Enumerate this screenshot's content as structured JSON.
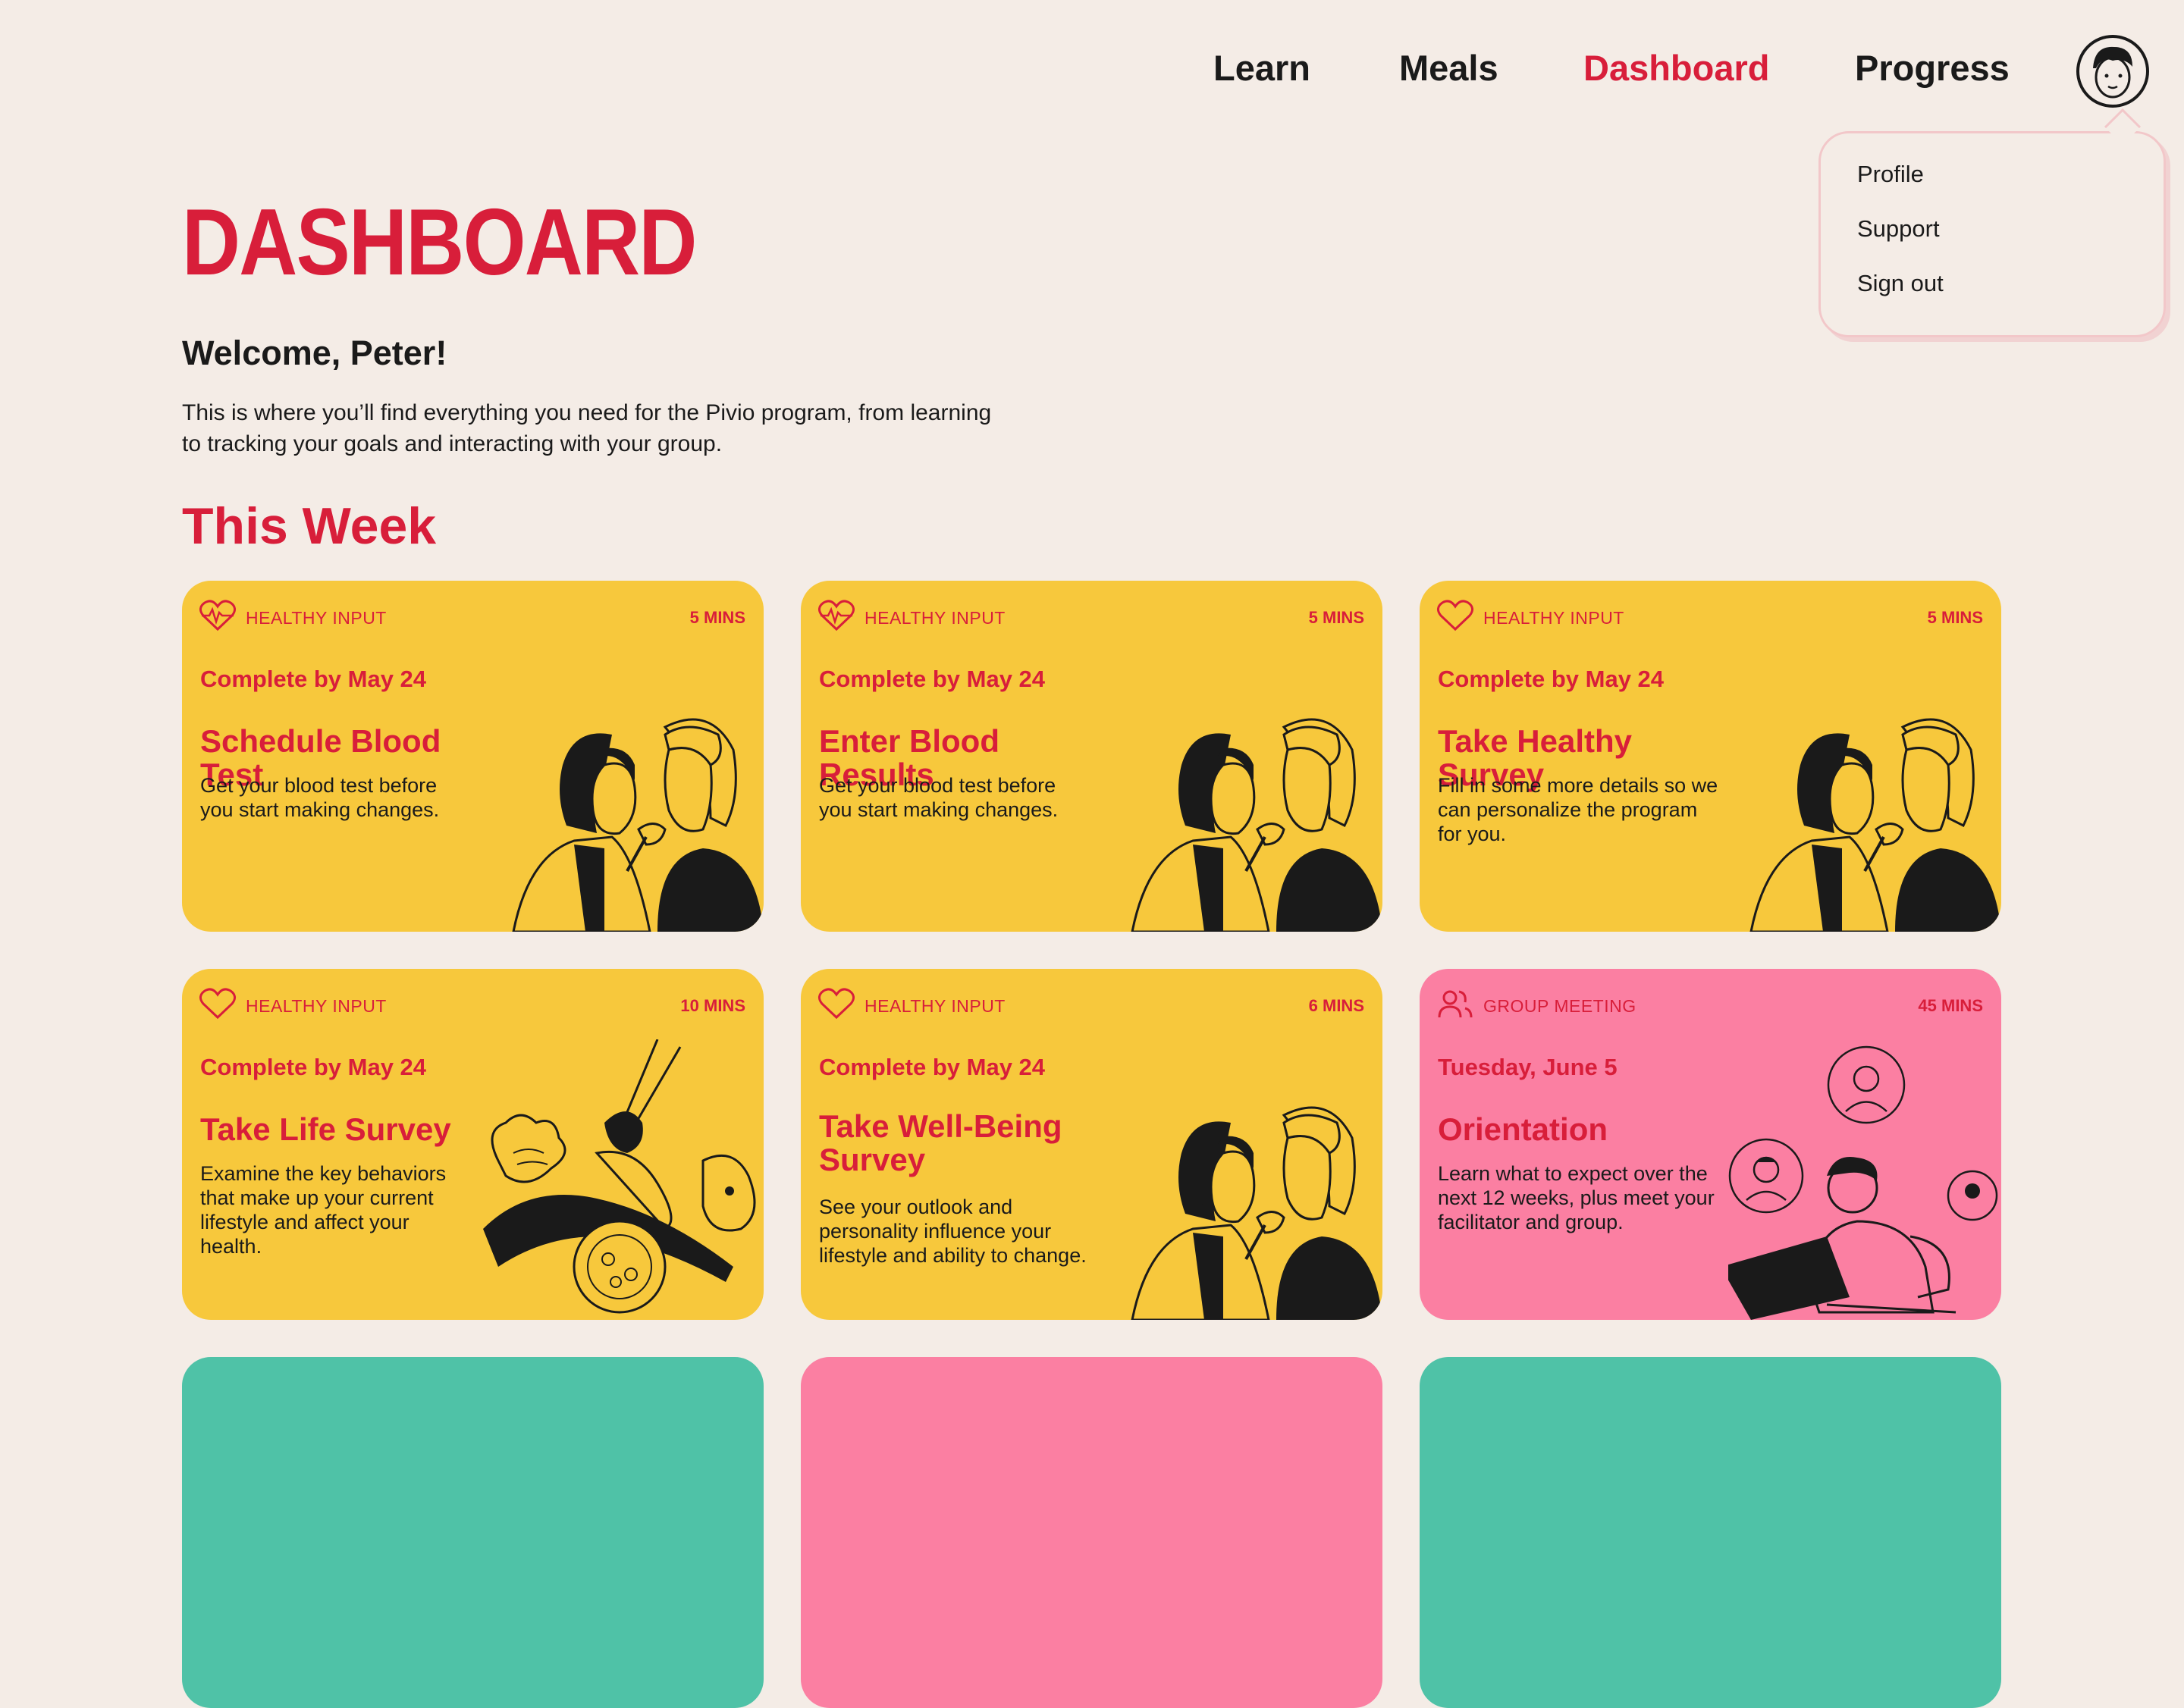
{
  "nav": {
    "items": [
      {
        "label": "Learn"
      },
      {
        "label": "Meals"
      },
      {
        "label": "Dashboard"
      },
      {
        "label": "Progress"
      }
    ]
  },
  "user_menu": {
    "items": [
      {
        "label": "Profile"
      },
      {
        "label": "Support"
      },
      {
        "label": "Sign out"
      }
    ]
  },
  "page": {
    "title": "DASHBOARD",
    "welcome": "Welcome, Peter!",
    "intro_line1": "This is where you’ll find everything you need for the Pivio program, from learning",
    "intro_line2": "to tracking your goals and interacting with your group.",
    "section_title": "This Week"
  },
  "colors": {
    "accent": "#D81E3A",
    "background": "#F4ECE6",
    "card_yellow": "#F7C83C",
    "card_pink": "#FB7FA2",
    "card_teal": "#4FC2A7"
  },
  "cards": [
    {
      "category": "HEALTHY INPUT",
      "duration": "5 MINS",
      "due": "Complete by May 24",
      "title": "Schedule Blood Test",
      "desc": [
        "Get your blood test before",
        "you start making changes."
      ],
      "icon": "heart-pulse-icon",
      "image": "doctor-patient-illustration"
    },
    {
      "category": "HEALTHY INPUT",
      "duration": "5 MINS",
      "due": "Complete by May 24",
      "title": "Enter Blood Results",
      "desc": [
        "Get your blood test before",
        "you start making changes."
      ],
      "icon": "heart-pulse-icon",
      "image": "doctor-patient-illustration"
    },
    {
      "category": "HEALTHY INPUT",
      "duration": "5 MINS",
      "due": "Complete by May 24",
      "title": "Take Healthy Survey",
      "desc": [
        "Fill in some more details so we",
        "can personalize the program",
        "for you."
      ],
      "icon": "heart-icon",
      "image": "doctor-patient-illustration"
    },
    {
      "category": "HEALTHY INPUT",
      "duration": "10 MINS",
      "due": "Complete by May 24",
      "title": "Take Life Survey",
      "desc": [
        "Examine the key behaviors",
        "that make up your current",
        "lifestyle and affect your",
        "health."
      ],
      "icon": "heart-icon",
      "image": "yoga-vegetables-illustration"
    },
    {
      "category": "HEALTHY INPUT",
      "duration": "6 MINS",
      "due": "Complete by May 24",
      "title_line1": "Take Well-Being",
      "title_line2": "Survey",
      "desc": [
        "See your outlook and",
        "personality influence your",
        "lifestyle and ability to change."
      ],
      "icon": "heart-icon",
      "image": "doctor-patient-illustration"
    },
    {
      "category": "GROUP MEETING",
      "duration": "45 MINS",
      "due": "Tuesday, June 5",
      "title": "Orientation",
      "desc": [
        "Learn what to expect over the",
        "next 12 weeks, plus meet your",
        "facilitator and group."
      ],
      "icon": "group-icon",
      "image": "video-meeting-illustration"
    }
  ]
}
